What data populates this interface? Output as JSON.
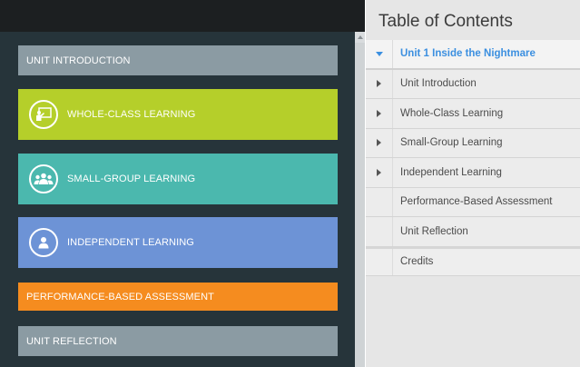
{
  "left": {
    "cards": [
      {
        "label": "UNIT INTRODUCTION"
      },
      {
        "label": "WHOLE-CLASS LEARNING",
        "icon": "teacher-board-icon"
      },
      {
        "label": "SMALL-GROUP LEARNING",
        "icon": "group-people-icon"
      },
      {
        "label": "INDEPENDENT LEARNING",
        "icon": "single-person-icon"
      },
      {
        "label": "PERFORMANCE-BASED ASSESSMENT"
      },
      {
        "label": "UNIT REFLECTION"
      }
    ],
    "colors": {
      "background": "#26343a",
      "gray": "#8b9ba3",
      "green": "#b5cf2a",
      "teal": "#4bb8ae",
      "blue": "#6d93d6",
      "orange": "#f58c1f"
    }
  },
  "toc": {
    "title": "Table of Contents",
    "items": [
      {
        "label": "Unit 1 Inside the Nightmare",
        "state": "expanded"
      },
      {
        "label": "Unit Introduction",
        "state": "collapsed"
      },
      {
        "label": "Whole-Class Learning",
        "state": "collapsed"
      },
      {
        "label": "Small-Group Learning",
        "state": "collapsed"
      },
      {
        "label": "Independent Learning",
        "state": "collapsed"
      },
      {
        "label": "Performance-Based Assessment",
        "state": "leaf"
      },
      {
        "label": "Unit Reflection",
        "state": "leaf"
      },
      {
        "label": "Credits",
        "state": "leaf"
      }
    ],
    "accent": "#3b8fe0"
  }
}
